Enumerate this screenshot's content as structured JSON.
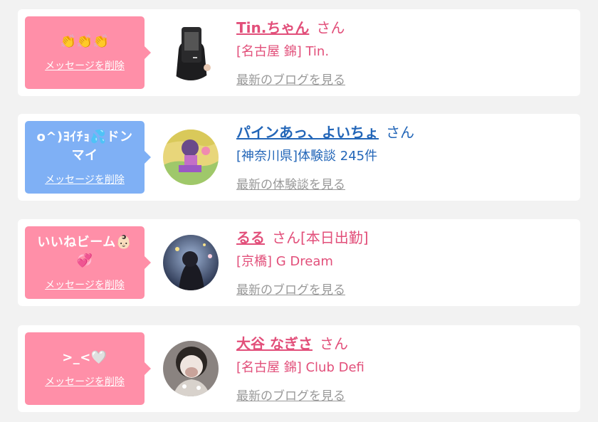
{
  "cards": [
    {
      "message": "👏👏👏",
      "delete_label": "メッセージを削除",
      "name": "Tin.ちゃん",
      "suffix": "さん",
      "status": "",
      "shop": "[名古屋 錦] Tin.",
      "link": "最新のブログを見る",
      "avatar_icon": "avatar-photo",
      "theme_color": "#ff8fa8"
    },
    {
      "message": "o^)ﾖｲﾁｮ💦ドンマイ",
      "delete_label": "メッセージを削除",
      "name": "パインあっ、よいちょ",
      "suffix": "さん",
      "status": "",
      "shop": "[神奈川県]体験談 245件",
      "link": "最新の体験談を見る",
      "avatar_icon": "avatar-photo",
      "theme_color": "#7fb0f5"
    },
    {
      "message": "いいねビーム👶🏻💞",
      "delete_label": "メッセージを削除",
      "name": "るる",
      "suffix": "さん",
      "status": "[本日出勤]",
      "shop": "[京橋] G Dream",
      "link": "最新のブログを見る",
      "avatar_icon": "avatar-photo",
      "theme_color": "#ff8fa8"
    },
    {
      "message": ">_<🤍",
      "delete_label": "メッセージを削除",
      "name": "大谷 なぎさ",
      "suffix": "さん",
      "status": "",
      "shop": "[名古屋 錦] Club Defi",
      "link": "最新のブログを見る",
      "avatar_icon": "avatar-photo",
      "theme_color": "#ff8fa8"
    }
  ]
}
